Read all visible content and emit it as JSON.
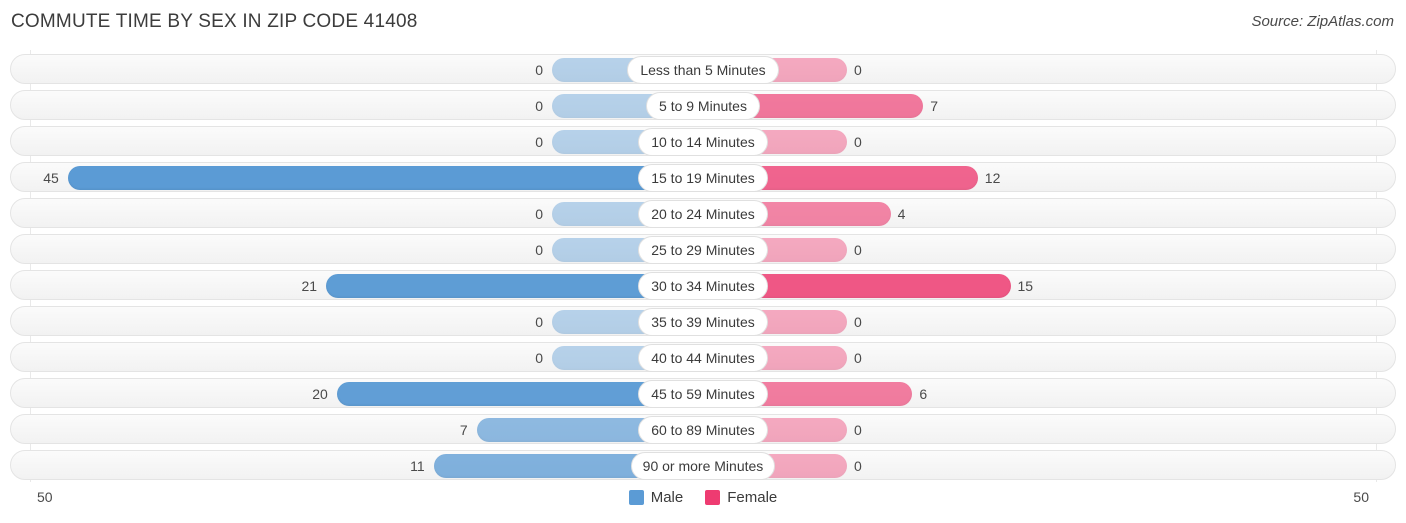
{
  "header": {
    "title": "COMMUTE TIME BY SEX IN ZIP CODE 41408",
    "source": "Source: ZipAtlas.com"
  },
  "legend": {
    "items": [
      {
        "label": "Male",
        "color": "#5B9BD5"
      },
      {
        "label": "Female",
        "color": "#EE3B71"
      }
    ]
  },
  "axis": {
    "left_tick": "50",
    "right_tick": "50"
  },
  "chart_data": {
    "type": "bar",
    "subtype": "diverging-bidirectional-bar",
    "title": "COMMUTE TIME BY SEX IN ZIP CODE 41408",
    "xlabel": "",
    "ylabel": "",
    "xlim": [
      -50,
      50
    ],
    "axis_max": 50,
    "grid": true,
    "legend_position": "bottom-center",
    "categories": [
      "Less than 5 Minutes",
      "5 to 9 Minutes",
      "10 to 14 Minutes",
      "15 to 19 Minutes",
      "20 to 24 Minutes",
      "25 to 29 Minutes",
      "30 to 34 Minutes",
      "35 to 39 Minutes",
      "40 to 44 Minutes",
      "45 to 59 Minutes",
      "60 to 89 Minutes",
      "90 or more Minutes"
    ],
    "series": [
      {
        "name": "Male",
        "color": "#5B9BD5",
        "direction": "left",
        "values": [
          0,
          0,
          0,
          45,
          0,
          0,
          21,
          0,
          0,
          20,
          7,
          11
        ]
      },
      {
        "name": "Female",
        "color": "#EE3B71",
        "direction": "right",
        "values": [
          0,
          7,
          0,
          12,
          4,
          0,
          15,
          0,
          0,
          6,
          0,
          0
        ]
      }
    ]
  }
}
